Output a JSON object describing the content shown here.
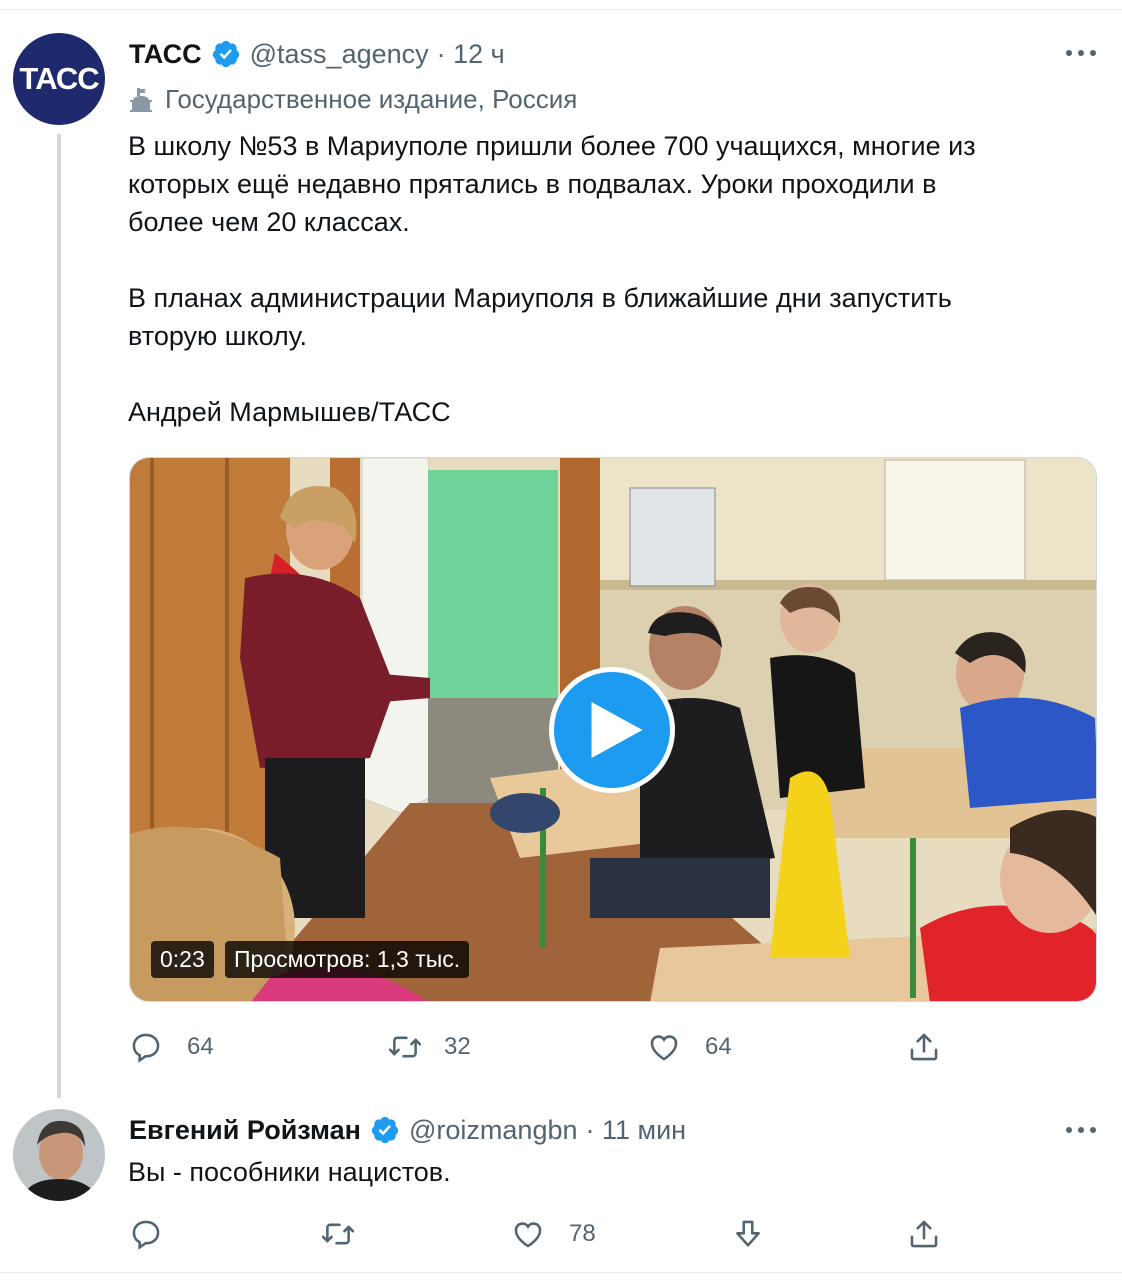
{
  "tweet1": {
    "avatar_text": "ТАСС",
    "name": "ТАСС",
    "handle": "@tass_agency",
    "time": "· 12 ч",
    "label": "Государственное издание, Россия",
    "text_lines": [
      "В школу №53 в Мариуполе пришли более 700 учащихся, многие из",
      "которых ещё недавно прятались в подвалах. Уроки проходили в",
      "более чем 20 классах.",
      "В планах администрации Мариуполя в ближайшие дни запустить",
      "вторую школу.",
      "Андрей Мармышев/ТАСС"
    ],
    "video": {
      "duration": "0:23",
      "views": "Просмотров: 1,3 тыс."
    },
    "actions": {
      "replies": "64",
      "retweets": "32",
      "likes": "64"
    }
  },
  "tweet2": {
    "name": "Евгений Ройзман",
    "handle": "@roizmangbn",
    "time": "· 11 мин",
    "text": "Вы - пособники нацистов.",
    "actions": {
      "replies": "",
      "retweets": "",
      "likes": "78"
    }
  },
  "colors": {
    "verified": "#1d9bf0",
    "secondary": "#536471",
    "play": "#1d9bf0",
    "tass_avatar": "#1f2a6e"
  },
  "icons": [
    "verified-badge-icon",
    "more-icon",
    "government-building-icon",
    "reply-icon",
    "retweet-icon",
    "like-icon",
    "share-icon",
    "downvote-icon",
    "play-icon"
  ]
}
